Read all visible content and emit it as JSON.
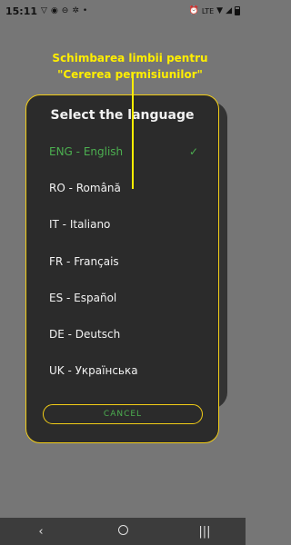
{
  "status_bar": {
    "time": "15:11",
    "network_label": "LTE"
  },
  "annotation": {
    "text": "Schimbarea limbii pentru \"Cererea permisiunilor\""
  },
  "dialog": {
    "title": "Select the language",
    "languages": [
      {
        "label": "ENG - English",
        "selected": true
      },
      {
        "label": "RO - Română",
        "selected": false
      },
      {
        "label": "IT - Italiano",
        "selected": false
      },
      {
        "label": "FR - Français",
        "selected": false
      },
      {
        "label": "ES - Español",
        "selected": false
      },
      {
        "label": "DE - Deutsch",
        "selected": false
      },
      {
        "label": "UK - Українська",
        "selected": false
      }
    ],
    "cancel_label": "CANCEL"
  },
  "colors": {
    "accent_yellow": "#f2cd17",
    "selected_green": "#4caf50",
    "dialog_bg": "#2b2b2b",
    "scrim": "#767676"
  }
}
